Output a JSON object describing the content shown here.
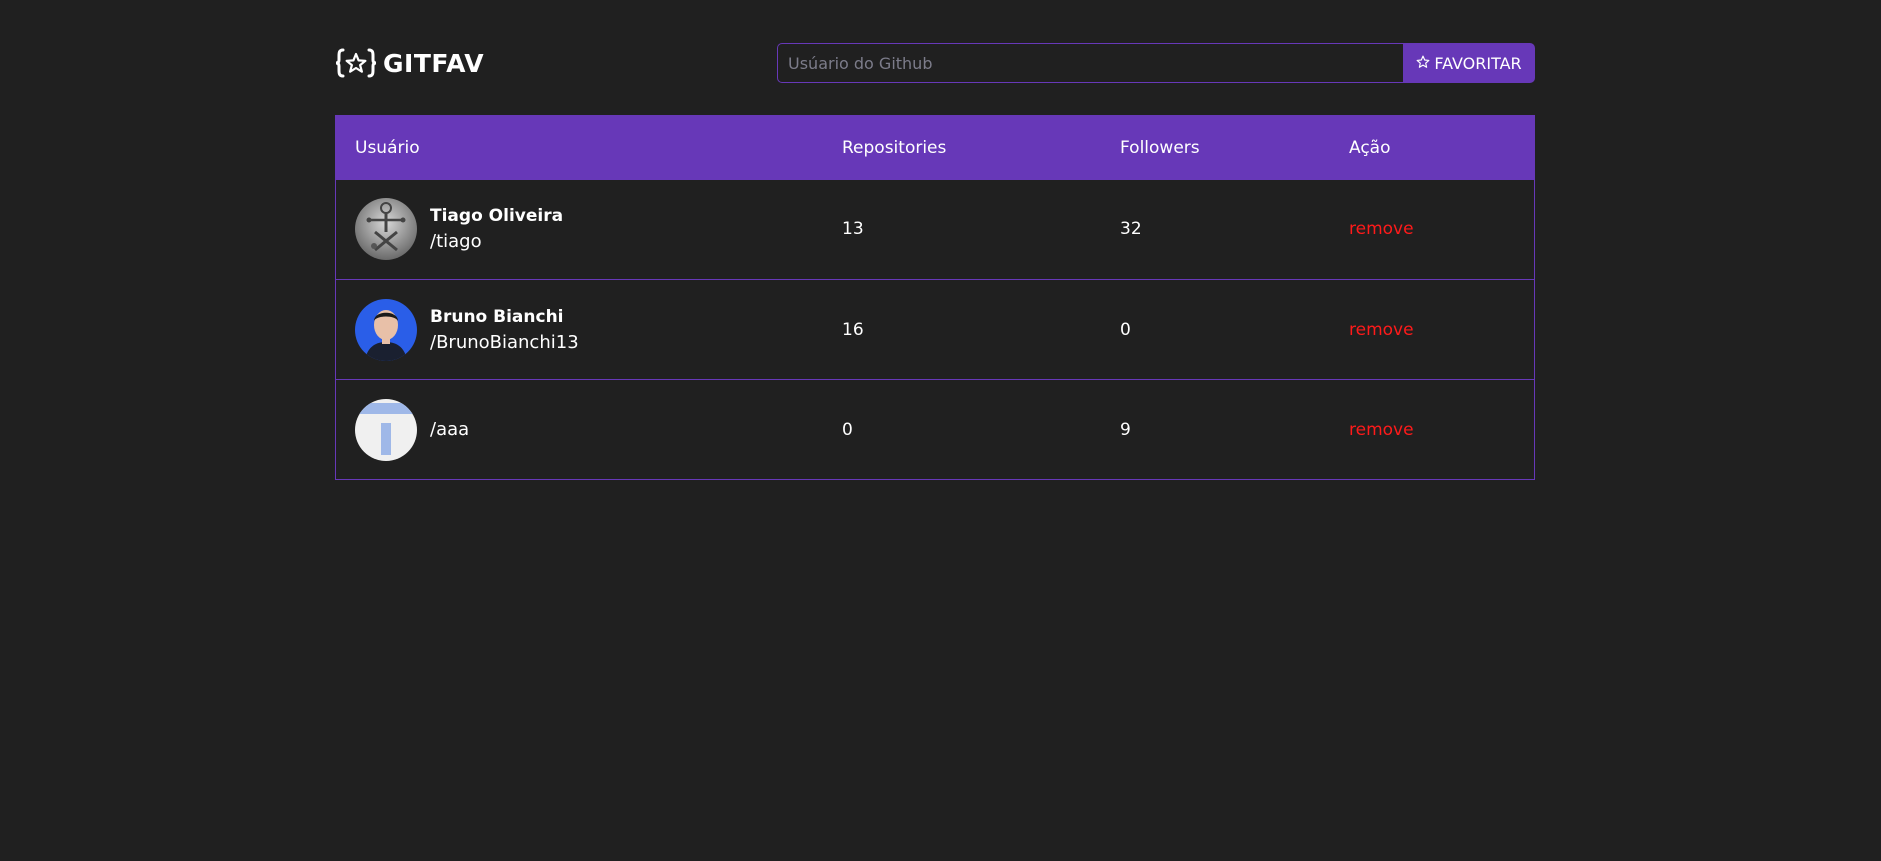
{
  "header": {
    "logo_text": "GITFAV",
    "logo_icon": "star-braces-icon"
  },
  "search": {
    "placeholder": "Usúario do Github",
    "value": "",
    "button_label": "FAVORITAR",
    "button_icon": "star-outline-icon"
  },
  "table": {
    "columns": [
      "Usuário",
      "Repositories",
      "Followers",
      "Ação"
    ],
    "rows": [
      {
        "name": "Tiago Oliveira",
        "login": "/tiago",
        "repositories": "13",
        "followers": "32",
        "action": "remove",
        "avatar": "gray-figure-avatar"
      },
      {
        "name": "Bruno Bianchi",
        "login": "/BrunoBianchi13",
        "repositories": "16",
        "followers": "0",
        "action": "remove",
        "avatar": "photo-avatar"
      },
      {
        "name": "",
        "login": "/aaa",
        "repositories": "0",
        "followers": "9",
        "action": "remove",
        "avatar": "blue-t-avatar"
      }
    ]
  },
  "colors": {
    "background": "#202020",
    "accent": "#6738b8",
    "remove": "#ff1a1a"
  }
}
